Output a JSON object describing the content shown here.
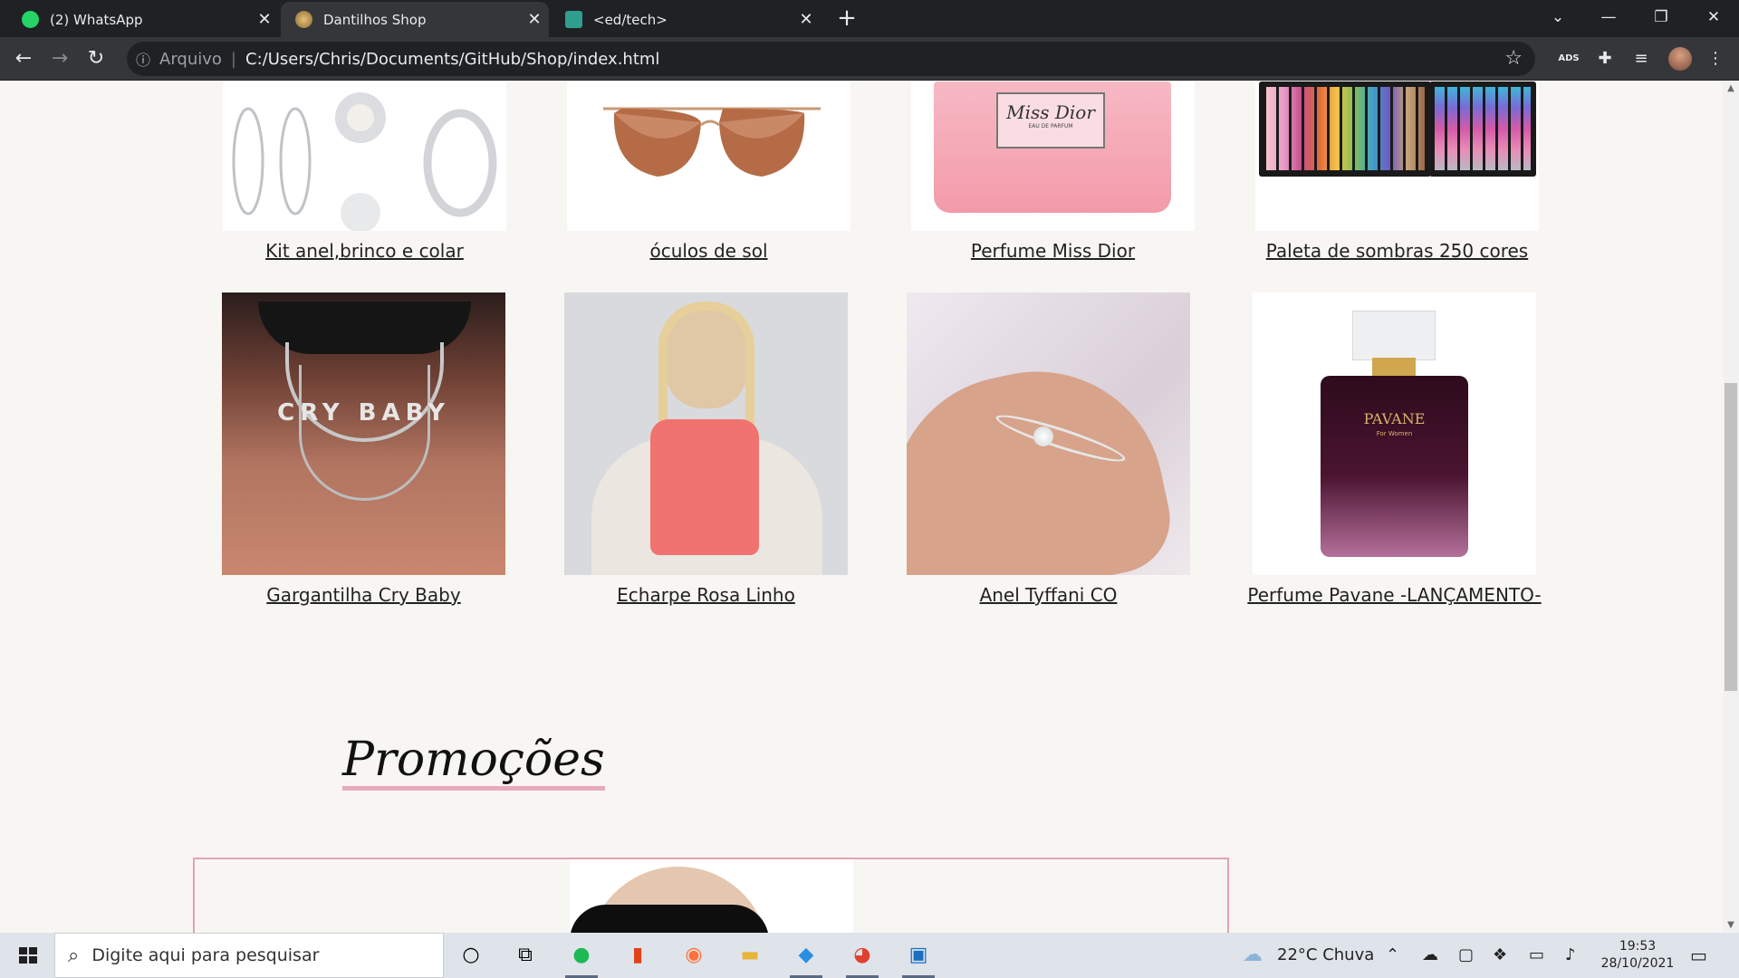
{
  "browser": {
    "tabs": [
      {
        "title": "(2) WhatsApp",
        "icon": "whatsapp-icon",
        "active": false,
        "color": "#25d366"
      },
      {
        "title": "Dantilhos Shop",
        "icon": "dantilhos-favicon-icon",
        "active": true,
        "color": "#c9a15a"
      },
      {
        "title": "<ed/tech>",
        "icon": "edtech-favicon-icon",
        "active": false,
        "color": "#2f9e8f"
      }
    ],
    "address": {
      "scheme_label": "Arquivo",
      "url": "C:/Users/Chris/Documents/GitHub/Shop/index.html"
    },
    "extension_ads": "ADS"
  },
  "products": [
    {
      "name": "Kit anel,brinco e colar"
    },
    {
      "name": "óculos de sol"
    },
    {
      "name": "Perfume Miss Dior"
    },
    {
      "name": "Paleta de sombras 250 cores"
    },
    {
      "name": "Gargantilha Cry Baby"
    },
    {
      "name": "Echarpe Rosa Linho"
    },
    {
      "name": "Anel Tyffani CO"
    },
    {
      "name": "Perfume Pavane -LANÇAMENTO-"
    }
  ],
  "product_image_text": {
    "miss_dior_label": "Miss Dior",
    "miss_dior_sub": "EAU DE PARFUM",
    "choker_letters": "CRY BABY",
    "pavane_label": "PAVANE",
    "pavane_sub": "For Women"
  },
  "promotions": {
    "title": "Promoções"
  },
  "taskbar": {
    "search_placeholder": "Digite aqui para pesquisar",
    "weather": "22°C  Chuva",
    "time": "19:53",
    "date": "28/10/2021"
  },
  "colors": {
    "accent_pink": "#e8a9be",
    "page_bg": "#f8f6f2",
    "browser_dark": "#202124"
  }
}
